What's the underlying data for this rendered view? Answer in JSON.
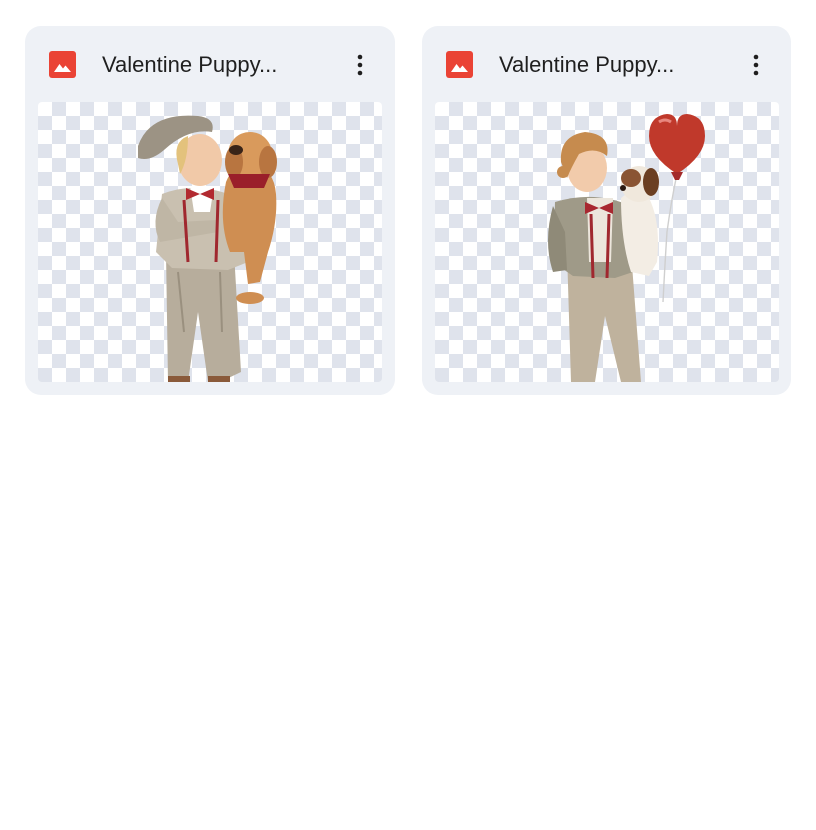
{
  "files": [
    {
      "title": "Valentine Puppy...",
      "icon": "image-file-icon",
      "menu_icon": "more-vert-icon"
    },
    {
      "title": "Valentine Puppy...",
      "icon": "image-file-icon",
      "menu_icon": "more-vert-icon"
    }
  ],
  "colors": {
    "card_background": "#eef1f6",
    "file_icon": "#ea4335",
    "text": "#1f1f1f"
  }
}
